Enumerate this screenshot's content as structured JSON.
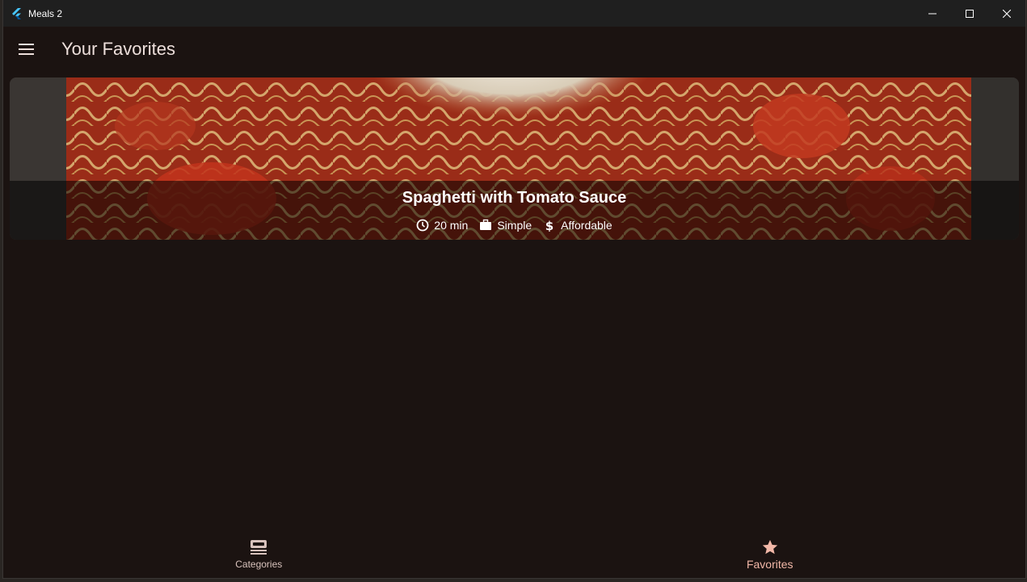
{
  "window": {
    "title": "Meals 2",
    "controls": [
      "minimize-icon",
      "maximize-icon",
      "close-icon"
    ]
  },
  "appbar": {
    "title": "Your Favorites",
    "menu_icon": "hamburger-menu-icon"
  },
  "meals": [
    {
      "title": "Spaghetti with Tomato Sauce",
      "duration": "20 min",
      "complexity": "Simple",
      "affordability": "Affordable"
    }
  ],
  "bottom_nav": {
    "items": [
      {
        "label": "Categories",
        "icon": "set-meal-icon",
        "active": false
      },
      {
        "label": "Favorites",
        "icon": "star-icon",
        "active": true
      }
    ]
  },
  "colors": {
    "background": "#1b1311",
    "accent": "#f2b8a8",
    "text": "#eddfdb"
  }
}
